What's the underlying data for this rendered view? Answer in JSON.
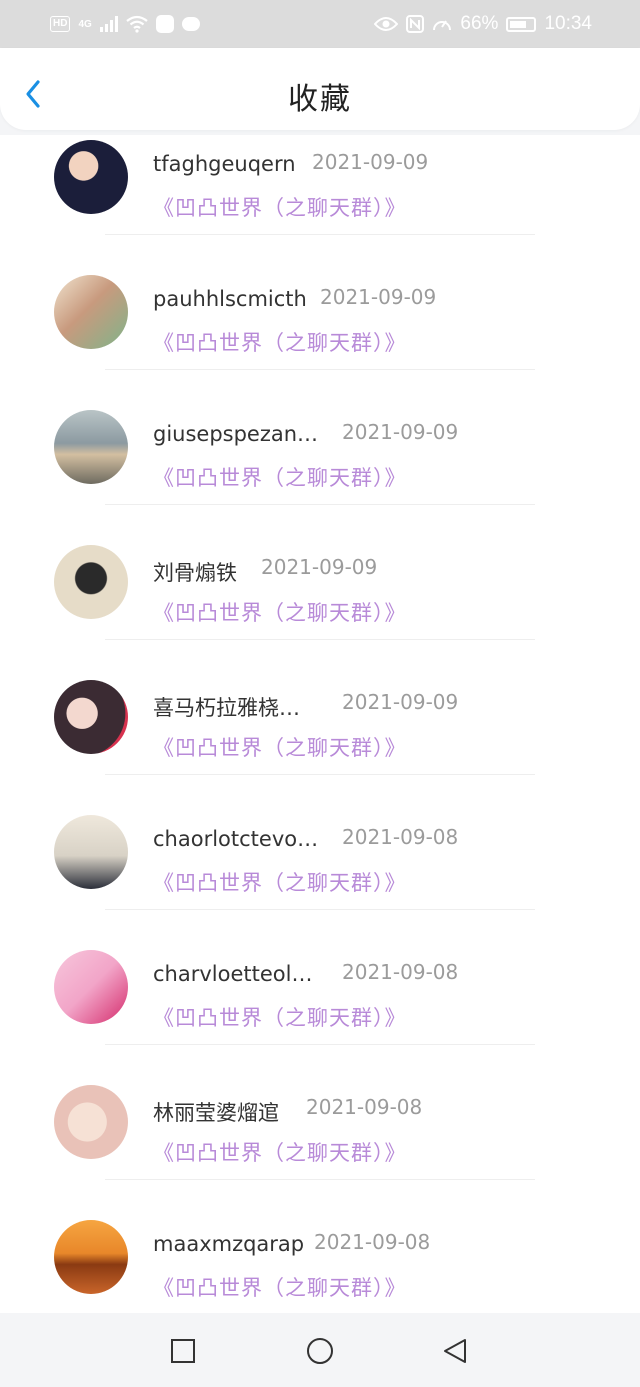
{
  "status_bar": {
    "hd": "HD",
    "signal": "4G",
    "battery": "66%",
    "time": "10:34"
  },
  "header": {
    "title": "收藏"
  },
  "items": [
    {
      "name": "tfaghgeuqern",
      "date": "2021-09-09",
      "group": "《凹凸世界（之聊天群）》",
      "avatar_color": "#2a2f52"
    },
    {
      "name": "pauhhlscmicth",
      "date": "2021-09-09",
      "group": "《凹凸世界（之聊天群）》",
      "avatar_color": "#c89a7e"
    },
    {
      "name": "giusepspezan…",
      "date": "2021-09-09",
      "group": "《凹凸世界（之聊天群）》",
      "avatar_color": "#8c9aa1"
    },
    {
      "name": "刘骨煽铁",
      "date": "2021-09-09",
      "group": "《凹凸世界（之聊天群）》",
      "avatar_color": "#e6dcc8"
    },
    {
      "name": "喜马朽拉雅桡…",
      "date": "2021-09-09",
      "group": "《凹凸世界（之聊天群）》",
      "avatar_color": "#6b4f5a"
    },
    {
      "name": "chaorlotctevo…",
      "date": "2021-09-08",
      "group": "《凹凸世界（之聊天群）》",
      "avatar_color": "#d8d2c6"
    },
    {
      "name": "charvloetteol…",
      "date": "2021-09-08",
      "group": "《凹凸世界（之聊天群）》",
      "avatar_color": "#f2a5c8"
    },
    {
      "name": "林丽莹婆熘逭",
      "date": "2021-09-08",
      "group": "《凹凸世界（之聊天群）》",
      "avatar_color": "#e9c2b8"
    },
    {
      "name": "maaxmzqarap",
      "date": "2021-09-08",
      "group": "《凹凸世界（之聊天群）》",
      "avatar_color": "#e8872a"
    }
  ],
  "colors": {
    "accent": "#1a8fe3",
    "group_text": "#b88ad8",
    "date_text": "#9b9b9b"
  }
}
